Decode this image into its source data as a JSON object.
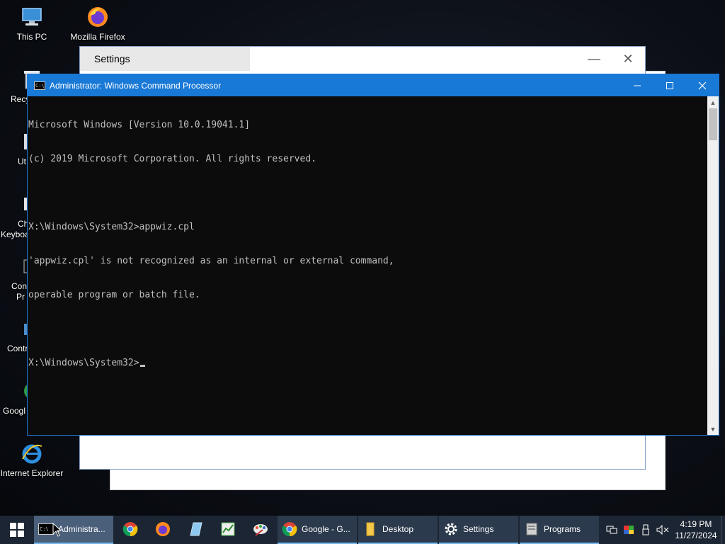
{
  "desktop": {
    "icons": [
      {
        "label": "This PC",
        "icon": "computer-icon"
      },
      {
        "label": "Mozilla Firefox",
        "icon": "firefox-icon"
      },
      {
        "label": "Recy",
        "icon": "recycle-bin-icon"
      },
      {
        "label": "Ut",
        "icon": "utility-icon"
      },
      {
        "label": "Ch",
        "label2": "Keyboa",
        "icon": "keyboard-icon"
      },
      {
        "label": "Con",
        "label2": "Pr",
        "icon": "command-prompt-icon"
      },
      {
        "label": "Contr",
        "icon": "control-panel-icon"
      },
      {
        "label": "Googl",
        "icon": "chrome-icon"
      },
      {
        "label": "Internet Explorer",
        "icon": "internet-explorer-icon"
      }
    ]
  },
  "settings_window": {
    "title": "Settings",
    "minimize": "—",
    "close": "✕"
  },
  "cmd_window": {
    "title": "Administrator: Windows Command Processor",
    "app_icon_text": "C:\\",
    "lines": [
      "Microsoft Windows [Version 10.0.19041.1]",
      "(c) 2019 Microsoft Corporation. All rights reserved.",
      "",
      "X:\\Windows\\System32>appwiz.cpl",
      "'appwiz.cpl' is not recognized as an internal or external command,",
      "operable program or batch file.",
      "",
      "X:\\Windows\\System32>"
    ]
  },
  "taskbar": {
    "items": [
      {
        "label": "Administra...",
        "icon": "cmd-icon",
        "active": true
      },
      {
        "label": "",
        "icon": "chrome-icon"
      },
      {
        "label": "",
        "icon": "firefox-icon"
      },
      {
        "label": "",
        "icon": "notepad-icon"
      },
      {
        "label": "",
        "icon": "task-manager-icon"
      },
      {
        "label": "",
        "icon": "paint-icon"
      },
      {
        "label": "Google - G...",
        "icon": "chrome-icon"
      },
      {
        "label": "Desktop",
        "icon": "folder-icon"
      },
      {
        "label": "Settings",
        "icon": "gear-icon"
      },
      {
        "label": "Programs",
        "icon": "programs-icon"
      }
    ],
    "clock_time": "4:19 PM",
    "clock_date": "11/27/2024"
  }
}
